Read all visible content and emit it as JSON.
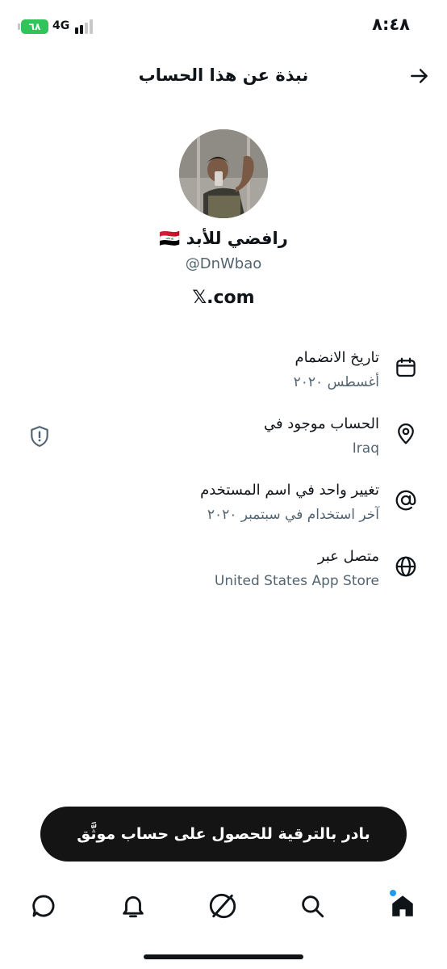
{
  "status_bar": {
    "time": "٨:٤٨",
    "battery_level": "٦٨",
    "network": "4G"
  },
  "header": {
    "title": "نبذة عن هذا الحساب"
  },
  "profile": {
    "display_name": "رافضي للأبد 🇮🇶",
    "handle": "@DnWbao",
    "site": "𝕏.com"
  },
  "info": [
    {
      "label": "تاريخ الانضمام",
      "value": "أغسطس ٢٠٢٠",
      "icon": "calendar-icon"
    },
    {
      "label": "الحساب موجود في",
      "value": "Iraq",
      "icon": "location-pin-icon"
    },
    {
      "label": "تغيير واحد في اسم المستخدم",
      "value": "آخر استخدام في سبتمبر ٢٠٢٠",
      "icon": "at-sign-icon"
    },
    {
      "label": "متصل عبر",
      "value": "United States App Store",
      "icon": "globe-icon"
    }
  ],
  "upgrade_banner": {
    "label": "بادر بالترقية للحصول على حساب موثَّق"
  },
  "nav": {
    "items": [
      "home-icon",
      "search-icon",
      "grok-icon",
      "notifications-icon",
      "messages-icon"
    ]
  },
  "colors": {
    "text": "#0f1419",
    "secondary_text": "#536471",
    "accent": "#1d9bf0",
    "battery": "#30c45a",
    "banner": "#141414"
  }
}
